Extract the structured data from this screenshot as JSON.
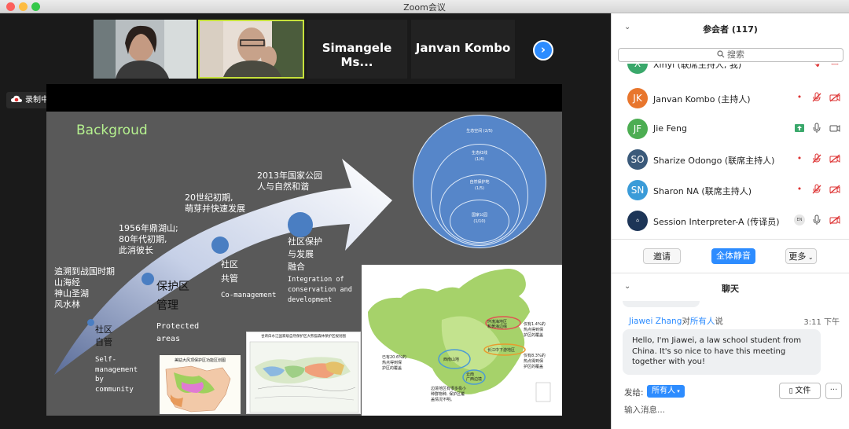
{
  "window": {
    "title": "Zoom会议"
  },
  "gallery": {
    "tiles": [
      {
        "kind": "video",
        "description": ""
      },
      {
        "kind": "video",
        "description": ""
      },
      {
        "kind": "name",
        "name": "Simangele Ms..."
      },
      {
        "kind": "name",
        "name": "Janvan Kombo"
      }
    ],
    "next_icon": "chevron-right-icon"
  },
  "recording": {
    "label": "录制中..."
  },
  "slide": {
    "title": "Backgroud",
    "timeline": [
      {
        "text": "追溯到战国时期\n山海经\n神山圣湖\n风水林"
      },
      {
        "text": "1956年鼎湖山;\n80年代初期,\n此消彼长"
      },
      {
        "text": "20世纪初期,\n萌芽并快速发展"
      },
      {
        "text": "2013年国家公园\n人与自然和谐"
      }
    ],
    "stages": [
      {
        "cn": "社区\n自管",
        "en": "Self-\nmanagement\nby\ncommunity"
      },
      {
        "cn": "保护区\n管理",
        "en": "Protected\nareas"
      },
      {
        "cn": "社区\n共管",
        "en": "Co-management"
      },
      {
        "cn": "社区保护\n与发展\n融合",
        "en": "Integration of\nconservation and\ndevelopment"
      }
    ],
    "circles": [
      {
        "label": "生态空间 (2/5)"
      },
      {
        "label": "生态红线\n(1/4)"
      },
      {
        "label": "自然保护地\n(1/5)"
      },
      {
        "label": "国家公园\n(1/10)"
      }
    ],
    "maps": [
      {
        "title": "美姑大风顶保护区功能区划图"
      },
      {
        "title": "甘肃白水江国家级自然保护区大熊猫森林保护区规划图"
      }
    ],
    "china_map": {
      "callouts": [
        {
          "label": "环渤海地区\n和黄海边缘"
        },
        {
          "label": "长江中下游地区"
        },
        {
          "label": "西南山地"
        },
        {
          "label": "云南\n广西边境"
        }
      ],
      "notes": [
        {
          "text": "仅有1.4%的\n热点得到保\n护区的覆盖"
        },
        {
          "text": "已有20.6%的\n热点得到保\n护区的覆盖"
        },
        {
          "text": "仅有8.3%的\n热点得到保\n护区的覆盖"
        },
        {
          "text": "边境地区有很多极小\n种群物种, 保护区覆\n盖情况不明。"
        }
      ]
    }
  },
  "participants": {
    "header": "参会者 (117)",
    "search_placeholder": "搜索",
    "list": [
      {
        "initials": "X",
        "name": "Xinyi (联席主持人, 我)",
        "color": "#3aa86b",
        "video": "off"
      },
      {
        "initials": "JK",
        "name": "Janvan Kombo (主持人)",
        "color": "#e8762d",
        "video": "off"
      },
      {
        "initials": "JF",
        "name": "Jie Feng",
        "color": "#4cad52",
        "video": "on"
      },
      {
        "initials": "SO",
        "name": "Sharize Odongo (联席主持人)",
        "color": "#3b5a7a",
        "video": "off"
      },
      {
        "initials": "SN",
        "name": "Sharon NA (联席主持人)",
        "color": "#3a9bd8",
        "video": "off"
      },
      {
        "initials": "",
        "name": "Session Interpreter-A (传译员)",
        "color": "#1d3557",
        "video": "off",
        "badge": "EN"
      }
    ],
    "buttons": {
      "invite": "邀请",
      "mute_all": "全体静音",
      "more": "更多"
    }
  },
  "chat": {
    "header": "聊天",
    "message": {
      "sender": "Jiawei Zhang",
      "to_prefix": "对",
      "recipient": "所有人",
      "suffix": "说",
      "time": "3:11 下午",
      "text": "Hello, I'm Jiawei, a law school student from China. It's so nice to have this meeting together with you!"
    },
    "send_to_label": "发给:",
    "send_to_value": "所有人",
    "file_label": "文件",
    "input_placeholder": "输入消息..."
  }
}
